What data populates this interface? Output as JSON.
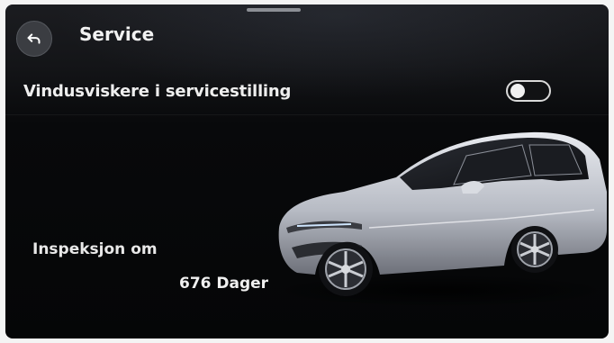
{
  "header": {
    "title": "Service",
    "back_icon": "back-arrow-icon"
  },
  "settings": {
    "wiper_service_mode": {
      "label": "Vindusviskere i servicestilling",
      "enabled": false
    }
  },
  "inspection": {
    "label": "Inspeksjon om",
    "value": "676 Dager"
  },
  "vehicle_image": "vehicle-illustration",
  "colors": {
    "background": "#08090b",
    "text": "#f0f0f0",
    "button": "#3b3d42",
    "toggle_border": "#d9d9d9"
  }
}
